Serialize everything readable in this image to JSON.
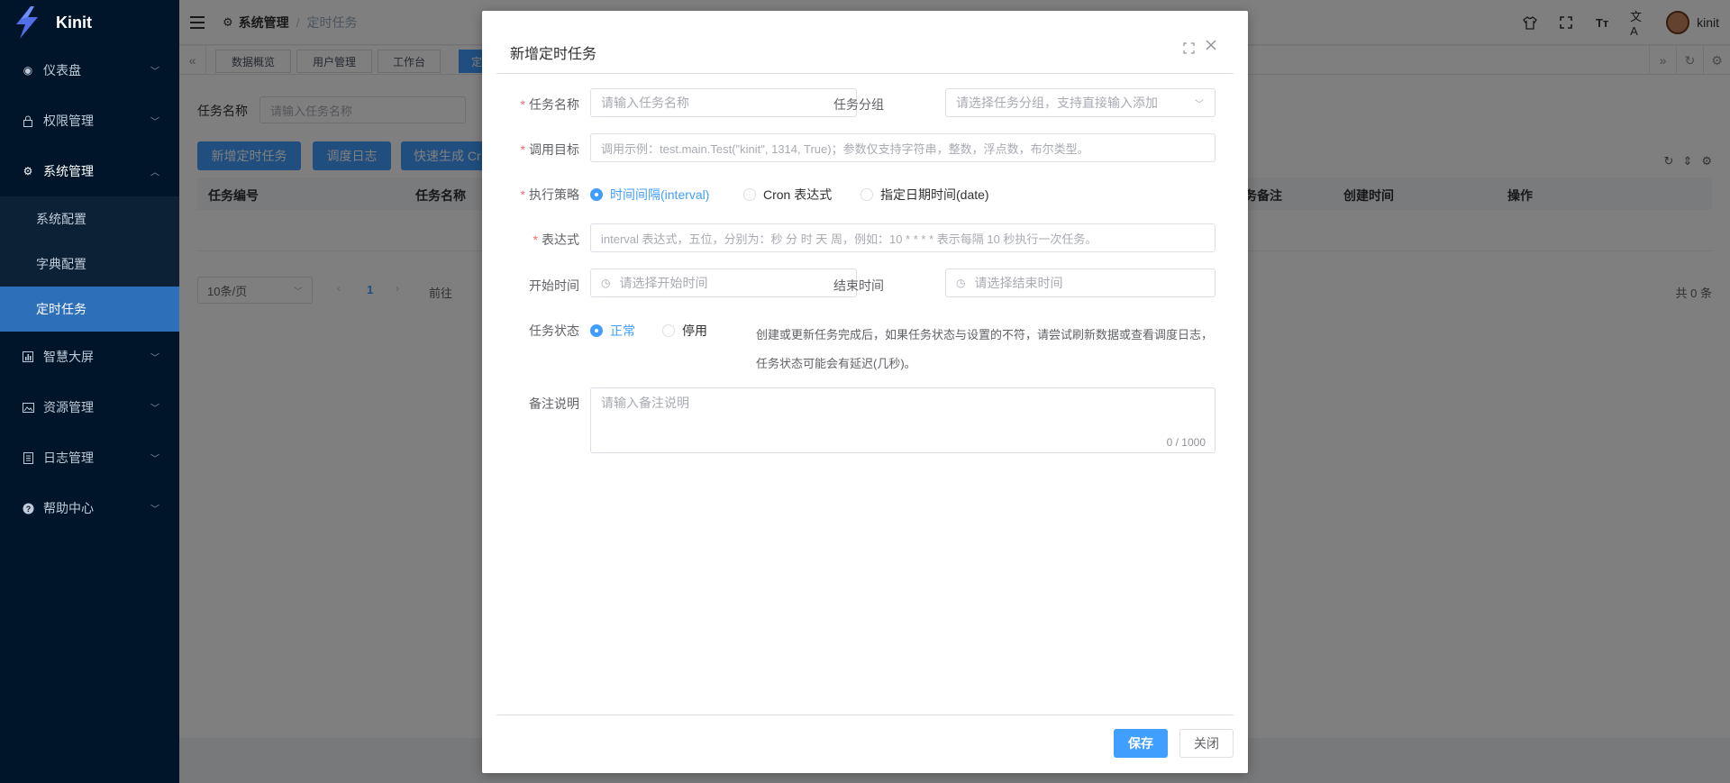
{
  "app": {
    "name": "Kinit"
  },
  "sidebar": {
    "items": [
      {
        "label": "仪表盘",
        "icon": "dashboard-icon"
      },
      {
        "label": "权限管理",
        "icon": "lock-icon"
      },
      {
        "label": "系统管理",
        "icon": "gear-icon"
      },
      {
        "label": "智慧大屏",
        "icon": "chart-icon"
      },
      {
        "label": "资源管理",
        "icon": "image-icon"
      },
      {
        "label": "日志管理",
        "icon": "document-icon"
      },
      {
        "label": "帮助中心",
        "icon": "help-icon"
      }
    ],
    "submenu": [
      "系统配置",
      "字典配置",
      "定时任务"
    ]
  },
  "header": {
    "breadcrumb_1": "系统管理",
    "breadcrumb_2": "定时任务",
    "user": "kinit"
  },
  "tags": [
    "数据概览",
    "用户管理",
    "工作台",
    "定"
  ],
  "page": {
    "search_label": "任务名称",
    "search_placeholder": "请输入任务名称",
    "buttons": [
      "新增定时任务",
      "调度日志",
      "快速生成 Cr"
    ],
    "columns": [
      "任务编号",
      "任务名称",
      "务备注",
      "创建时间",
      "操作"
    ],
    "page_size": "10条/页",
    "current_page": "1",
    "goto_label": "前往",
    "total": "共 0 条"
  },
  "dialog": {
    "title": "新增定时任务",
    "task_name_label": "任务名称",
    "task_name_placeholder": "请输入任务名称",
    "task_group_label": "任务分组",
    "task_group_placeholder": "请选择任务分组，支持直接输入添加",
    "target_label": "调用目标",
    "target_placeholder": "调用示例：test.main.Test(\"kinit\", 1314, True)；参数仅支持字符串，整数，浮点数，布尔类型。",
    "strategy_label": "执行策略",
    "strategy_options": [
      "时间间隔(interval)",
      "Cron 表达式",
      "指定日期时间(date)"
    ],
    "expr_label": "表达式",
    "expr_placeholder": "interval 表达式，五位，分别为：秒 分 时 天 周，例如：10 * * * * 表示每隔 10 秒执行一次任务。",
    "start_label": "开始时间",
    "start_placeholder": "请选择开始时间",
    "end_label": "结束时间",
    "end_placeholder": "请选择结束时间",
    "status_label": "任务状态",
    "status_options": [
      "正常",
      "停用"
    ],
    "status_note": "创建或更新任务完成后，如果任务状态与设置的不符，请尝试刷新数据或查看调度日志，任务状态可能会有延迟(几秒)。",
    "remark_label": "备注说明",
    "remark_placeholder": "请输入备注说明",
    "remark_count": "0 / 1000",
    "save": "保存",
    "close": "关闭"
  },
  "colors": {
    "primary": "#409eff",
    "sidebar": "#001529",
    "active_menu": "#2d6fb8",
    "required": "#f56c6c"
  }
}
